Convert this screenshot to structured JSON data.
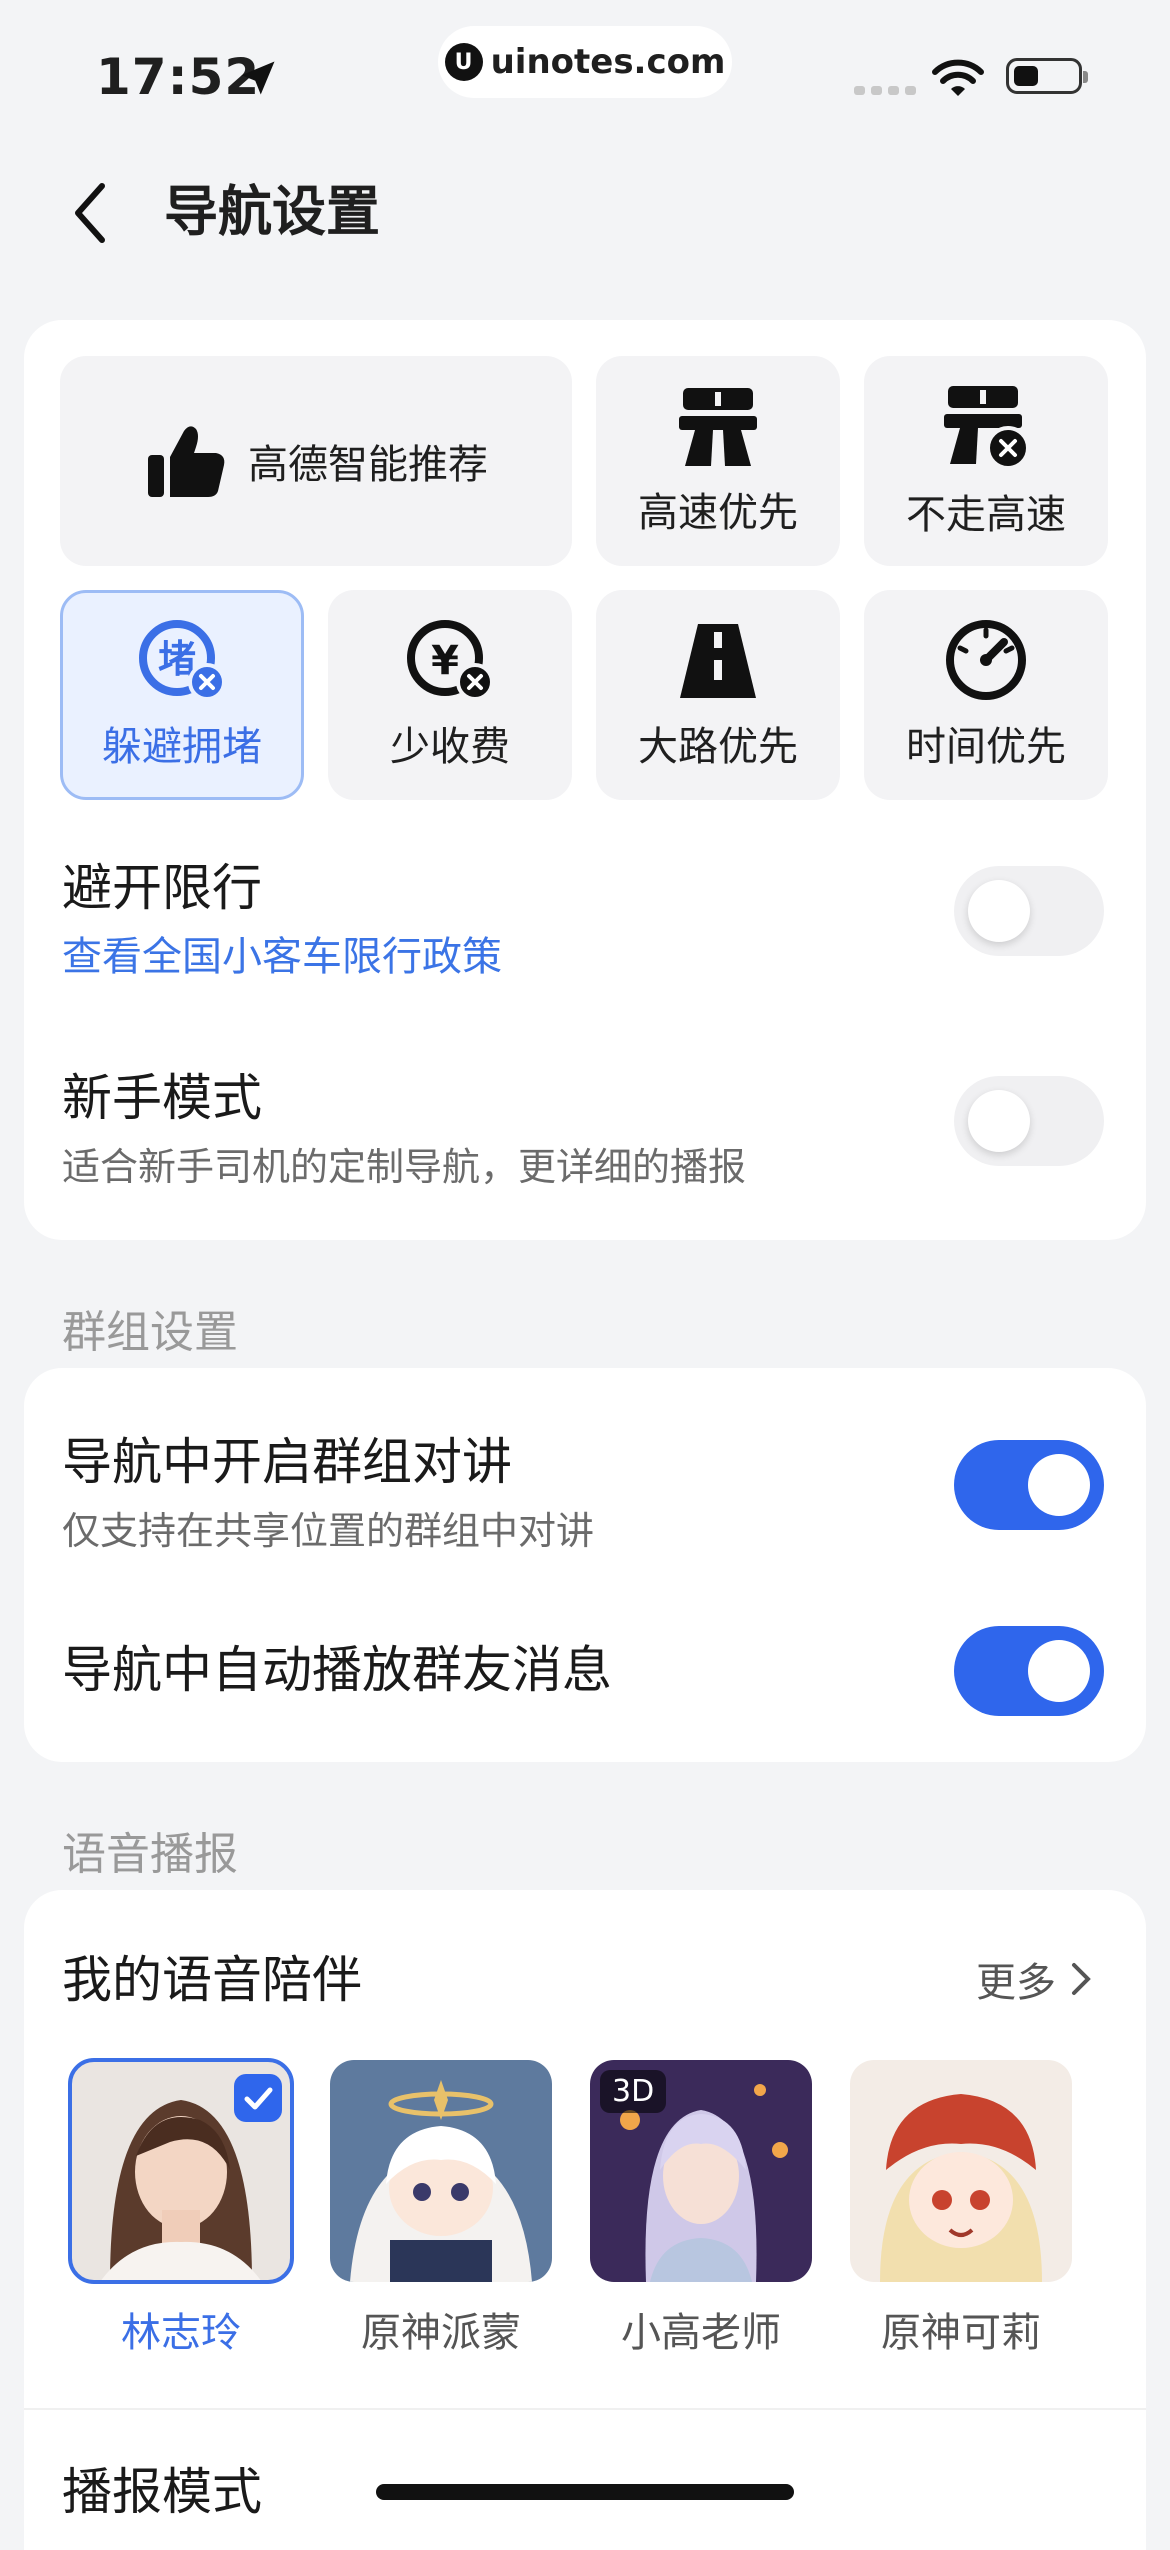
{
  "status_bar": {
    "time": "17:52",
    "url": "uinotes.com"
  },
  "header": {
    "title": "导航设置"
  },
  "route_options": [
    {
      "label": "高德智能推荐",
      "icon": "thumbs-up-icon",
      "selected": false
    },
    {
      "label": "高速优先",
      "icon": "highway-icon",
      "selected": false
    },
    {
      "label": "不走高速",
      "icon": "no-highway-icon",
      "selected": false
    },
    {
      "label": "躲避拥堵",
      "icon": "avoid-congestion-icon",
      "selected": true
    },
    {
      "label": "少收费",
      "icon": "no-toll-icon",
      "selected": false
    },
    {
      "label": "大路优先",
      "icon": "main-road-icon",
      "selected": false
    },
    {
      "label": "时间优先",
      "icon": "speedometer-icon",
      "selected": false
    }
  ],
  "settings": {
    "avoid_restriction": {
      "title": "避开限行",
      "link": "查看全国小客车限行政策",
      "enabled": false
    },
    "novice_mode": {
      "title": "新手模式",
      "subtitle": "适合新手司机的定制导航，更详细的播报",
      "enabled": false
    }
  },
  "group_section": {
    "label": "群组设置",
    "group_talk": {
      "title": "导航中开启群组对讲",
      "subtitle": "仅支持在共享位置的群组中对讲",
      "enabled": true
    },
    "auto_play": {
      "title": "导航中自动播放群友消息",
      "enabled": true
    }
  },
  "voice_section": {
    "label": "语音播报",
    "companion_title": "我的语音陪伴",
    "more": "更多",
    "voices": [
      {
        "name": "林志玲",
        "selected": true
      },
      {
        "name": "原神派蒙",
        "selected": false
      },
      {
        "name": "小高老师",
        "selected": false,
        "badge": "3D"
      },
      {
        "name": "原神可莉",
        "selected": false
      }
    ],
    "broadcast_mode_title": "播报模式"
  },
  "colors": {
    "accent": "#2f66ec",
    "link": "#3b74e6",
    "background": "#f3f4f6"
  }
}
